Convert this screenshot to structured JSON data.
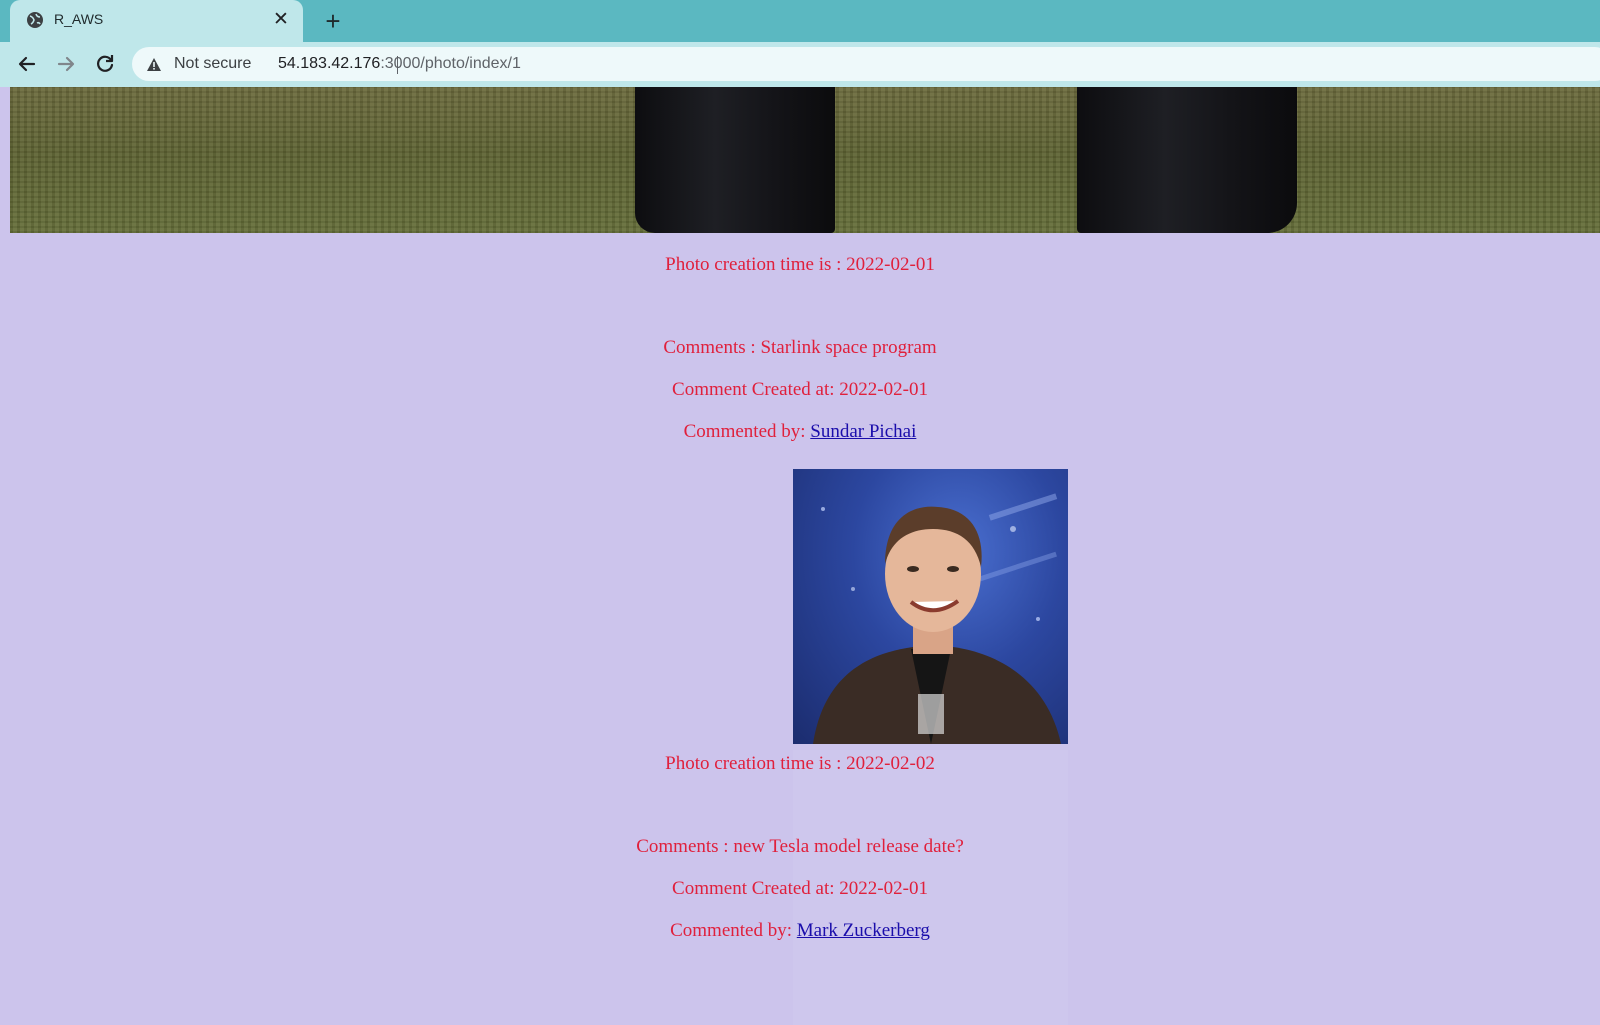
{
  "browser": {
    "tab_title": "R_AWS",
    "security_label": "Not secure",
    "url_host": "54.183.42.176",
    "url_path": ":3000/photo/index/1"
  },
  "posts": [
    {
      "photo_creation": "Photo creation time is : 2022-02-01",
      "comment": "Comments : Starlink space program",
      "comment_created": "Comment Created at: 2022-02-01",
      "commented_by_label": "Commented by: ",
      "commenter": "Sundar Pichai"
    },
    {
      "photo_creation": "Photo creation time is : 2022-02-02",
      "comment": "Comments : new Tesla model release date?",
      "comment_created": "Comment Created at: 2022-02-01",
      "commented_by_label": "Commented by: ",
      "commenter": "Mark Zuckerberg"
    }
  ],
  "colors": {
    "page_background": "#ccc4ec",
    "text": "#e0203c",
    "link": "#1a0dab",
    "tab_strip": "#5bb8c1",
    "toolbar": "#bfe7ea"
  }
}
